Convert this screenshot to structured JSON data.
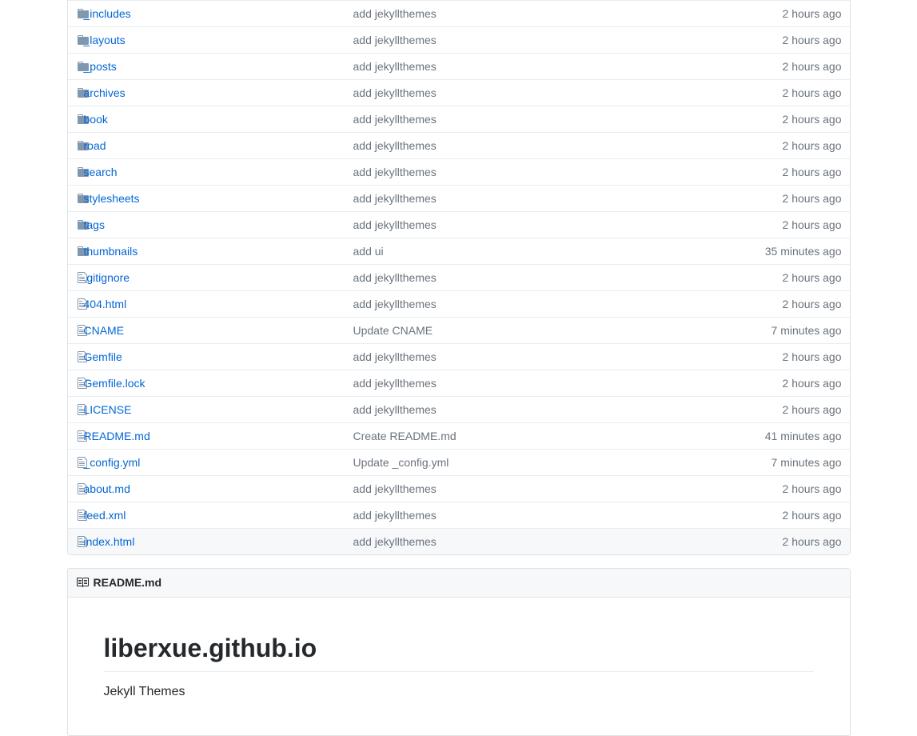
{
  "files": [
    {
      "type": "folder",
      "name": "_includes",
      "msg": "add jekyllthemes",
      "age": "2 hours ago"
    },
    {
      "type": "folder",
      "name": "_layouts",
      "msg": "add jekyllthemes",
      "age": "2 hours ago"
    },
    {
      "type": "folder",
      "name": "_posts",
      "msg": "add jekyllthemes",
      "age": "2 hours ago"
    },
    {
      "type": "folder",
      "name": "archives",
      "msg": "add jekyllthemes",
      "age": "2 hours ago"
    },
    {
      "type": "folder",
      "name": "book",
      "msg": "add jekyllthemes",
      "age": "2 hours ago"
    },
    {
      "type": "folder",
      "name": "road",
      "msg": "add jekyllthemes",
      "age": "2 hours ago"
    },
    {
      "type": "folder",
      "name": "search",
      "msg": "add jekyllthemes",
      "age": "2 hours ago"
    },
    {
      "type": "folder",
      "name": "stylesheets",
      "msg": "add jekyllthemes",
      "age": "2 hours ago"
    },
    {
      "type": "folder",
      "name": "tags",
      "msg": "add jekyllthemes",
      "age": "2 hours ago"
    },
    {
      "type": "folder",
      "name": "thumbnails",
      "msg": "add ui",
      "age": "35 minutes ago"
    },
    {
      "type": "file",
      "name": ".gitignore",
      "msg": "add jekyllthemes",
      "age": "2 hours ago"
    },
    {
      "type": "file",
      "name": "404.html",
      "msg": "add jekyllthemes",
      "age": "2 hours ago"
    },
    {
      "type": "file",
      "name": "CNAME",
      "msg": "Update CNAME",
      "age": "7 minutes ago"
    },
    {
      "type": "file",
      "name": "Gemfile",
      "msg": "add jekyllthemes",
      "age": "2 hours ago"
    },
    {
      "type": "file",
      "name": "Gemfile.lock",
      "msg": "add jekyllthemes",
      "age": "2 hours ago"
    },
    {
      "type": "file",
      "name": "LICENSE",
      "msg": "add jekyllthemes",
      "age": "2 hours ago"
    },
    {
      "type": "file",
      "name": "README.md",
      "msg": "Create README.md",
      "age": "41 minutes ago"
    },
    {
      "type": "file",
      "name": "_config.yml",
      "msg": "Update _config.yml",
      "age": "7 minutes ago"
    },
    {
      "type": "file",
      "name": "about.md",
      "msg": "add jekyllthemes",
      "age": "2 hours ago"
    },
    {
      "type": "file",
      "name": "feed.xml",
      "msg": "add jekyllthemes",
      "age": "2 hours ago"
    },
    {
      "type": "file",
      "name": "index.html",
      "msg": "add jekyllthemes",
      "age": "2 hours ago"
    }
  ],
  "readme": {
    "filename": "README.md",
    "title": "liberxue.github.io",
    "subtitle": "Jekyll Themes"
  }
}
